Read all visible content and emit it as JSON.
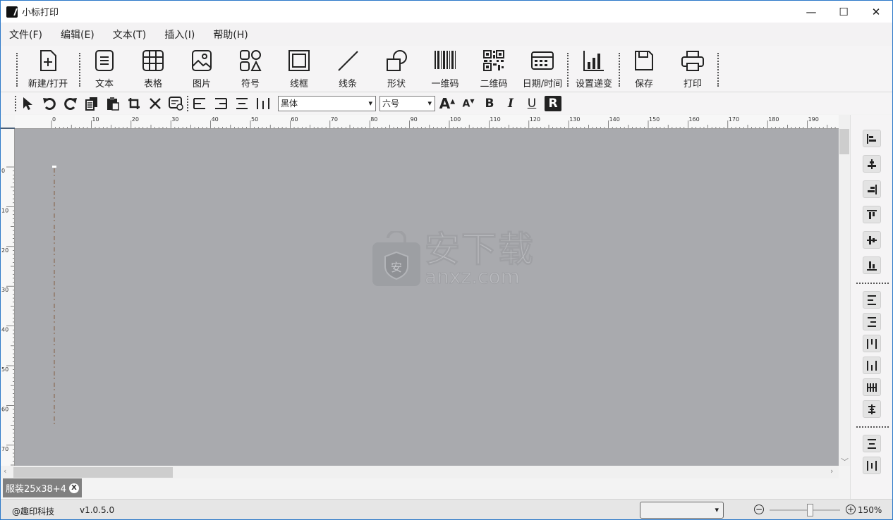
{
  "window": {
    "title": "小标打印",
    "controls": {
      "minimize": "—",
      "maximize": "☐",
      "close": "✕"
    }
  },
  "menu": [
    "文件(F)",
    "编辑(E)",
    "文本(T)",
    "插入(I)",
    "帮助(H)"
  ],
  "toolbar": {
    "items": [
      {
        "label": "新建/打开",
        "icon": "new-file-icon"
      },
      {
        "label": "文本",
        "icon": "text-icon"
      },
      {
        "label": "表格",
        "icon": "table-icon"
      },
      {
        "label": "图片",
        "icon": "image-icon"
      },
      {
        "label": "符号",
        "icon": "symbol-icon"
      },
      {
        "label": "线框",
        "icon": "frame-icon"
      },
      {
        "label": "线条",
        "icon": "line-icon"
      },
      {
        "label": "形状",
        "icon": "shape-icon"
      },
      {
        "label": "一维码",
        "icon": "barcode-icon"
      },
      {
        "label": "二维码",
        "icon": "qrcode-icon"
      },
      {
        "label": "日期/时间",
        "icon": "calendar-icon"
      },
      {
        "label": "设置递变",
        "icon": "increment-icon"
      },
      {
        "label": "保存",
        "icon": "save-icon"
      },
      {
        "label": "打印",
        "icon": "printer-icon"
      }
    ]
  },
  "format": {
    "font_family": "黑体",
    "font_size": "六号",
    "bold": "B",
    "italic": "I",
    "underline": "U",
    "rotate": "R"
  },
  "ruler": {
    "h_labels": [
      "0",
      "10",
      "20",
      "30",
      "40",
      "50",
      "60",
      "70",
      "80",
      "90",
      "100",
      "110",
      "120",
      "130",
      "140",
      "150",
      "160",
      "170",
      "180",
      "190"
    ],
    "v_labels": [
      "0",
      "10",
      "20",
      "30",
      "40",
      "50",
      "60",
      "70"
    ]
  },
  "watermark": {
    "big": "安下载",
    "small": "anxz.com",
    "shield_char": "安"
  },
  "doc_tab": {
    "name": "服装25x38+4",
    "close": "X"
  },
  "status": {
    "company": "@趣印科技",
    "version": "v1.0.5.0",
    "dropdown_value": "",
    "zoom": "150%",
    "zoom_level_percent": 150
  },
  "colors": {
    "canvas": "#a9aaae",
    "accent": "#2b78c8"
  }
}
